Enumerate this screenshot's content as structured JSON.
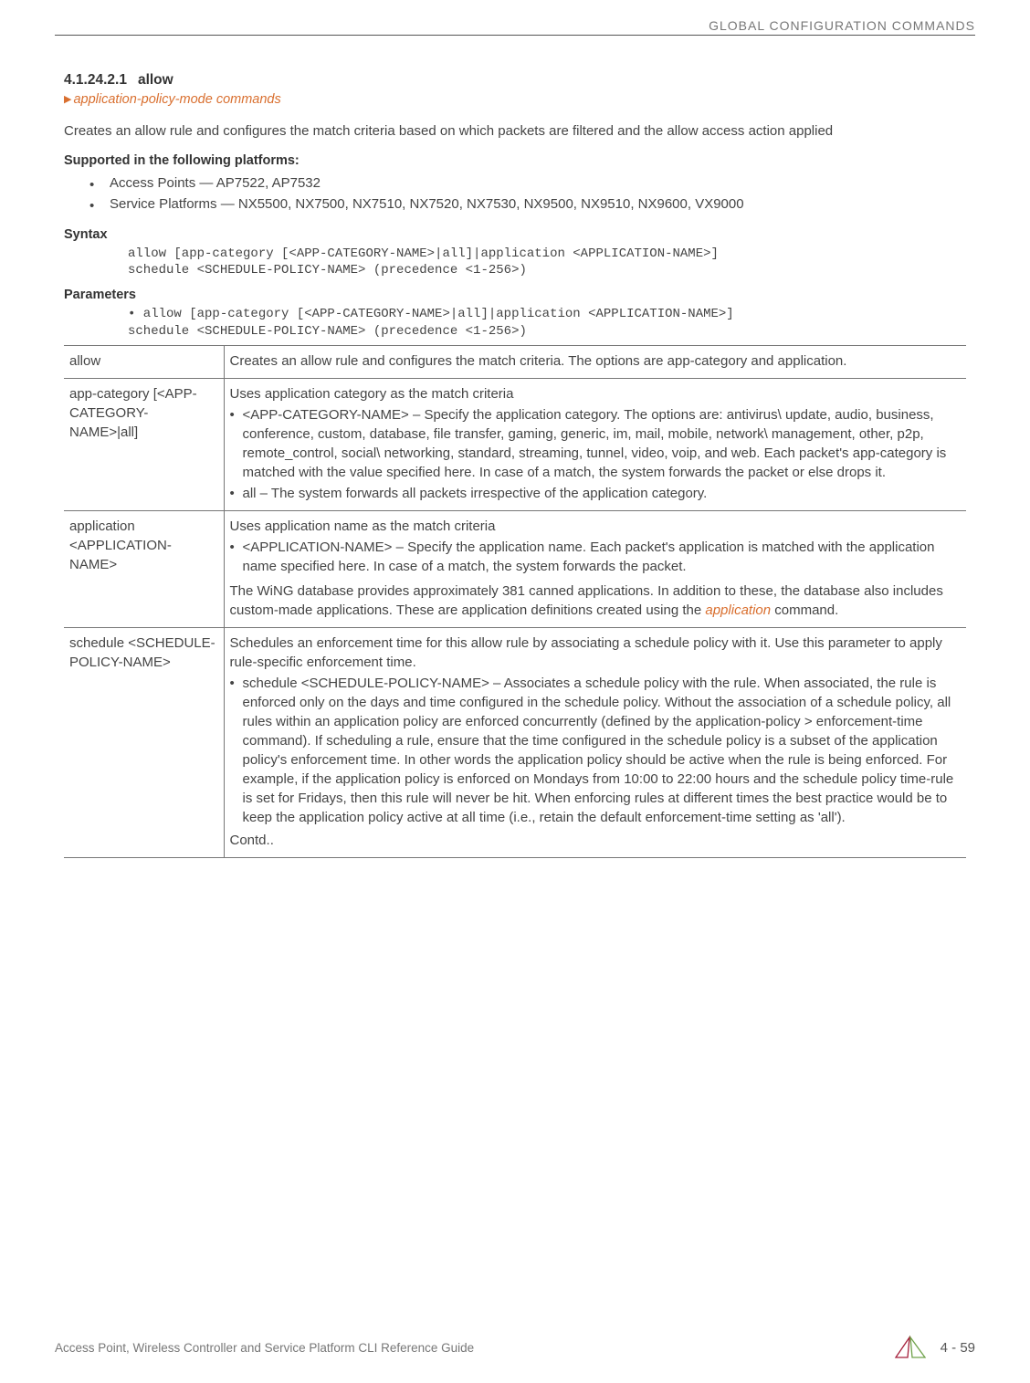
{
  "header": {
    "chapter": "GLOBAL CONFIGURATION COMMANDS"
  },
  "section": {
    "number": "4.1.24.2.1",
    "title": "allow",
    "breadcrumb": "application-policy-mode commands"
  },
  "intro": "Creates an allow rule and configures the match criteria based on which packets are filtered and the allow access action applied",
  "supported": {
    "heading": "Supported in the following platforms:",
    "items": [
      "Access Points — AP7522, AP7532",
      "Service Platforms — NX5500, NX7500, NX7510, NX7520, NX7530, NX9500, NX9510, NX9600, VX9000"
    ]
  },
  "syntax": {
    "heading": "Syntax",
    "code": "allow [app-category [<APP-CATEGORY-NAME>|all]|application <APPLICATION-NAME>]\nschedule <SCHEDULE-POLICY-NAME> (precedence <1-256>)"
  },
  "parameters": {
    "heading": "Parameters",
    "code": "• allow [app-category [<APP-CATEGORY-NAME>|all]|application <APPLICATION-NAME>]\nschedule <SCHEDULE-POLICY-NAME> (precedence <1-256>)",
    "rows": [
      {
        "key": "allow",
        "desc_intro": "Creates an allow rule and configures the match criteria. The options are app-category and application.",
        "bullets": [],
        "desc_outro": ""
      },
      {
        "key": "app-category [<APP-CATEGORY-NAME>|all]",
        "desc_intro": "Uses application category as the match criteria",
        "bullets": [
          "<APP-CATEGORY-NAME> – Specify the application category. The options are: antivirus\\ update, audio, business, conference, custom, database, file transfer, gaming, generic, im, mail, mobile, network\\ management, other, p2p, remote_control, social\\ networking, standard, streaming, tunnel, video, voip, and web. Each packet's app-category is matched with the value specified here. In case of a match, the system forwards the packet or else drops it.",
          "all – The system forwards all packets irrespective of the application category."
        ],
        "desc_outro": ""
      },
      {
        "key": "application <APPLICATION-NAME>",
        "desc_intro": "Uses application name as the match criteria",
        "bullets": [
          "<APPLICATION-NAME> – Specify the application name. Each packet's application is matched with the application name specified here. In case of a match, the system forwards the packet."
        ],
        "desc_outro_pre": "The WiNG database provides approximately 381 canned applications. In addition to these, the database also includes custom-made applications. These are application definitions created using the ",
        "desc_outro_link": "application",
        "desc_outro_post": " command."
      },
      {
        "key": "schedule <SCHEDULE-POLICY-NAME>",
        "desc_intro": "Schedules an enforcement time for this allow rule by associating a schedule policy with it. Use this parameter to apply rule-specific enforcement time.",
        "bullets": [
          "schedule <SCHEDULE-POLICY-NAME> – Associates a schedule policy with the rule. When associated, the rule is enforced only on the days and time configured in the schedule policy. Without the association of a schedule policy, all rules within an application policy are enforced concurrently (defined by the application-policy > enforcement-time command). If scheduling a rule, ensure that the time configured in the schedule policy is a subset of the application policy's enforcement time. In other words the application policy should be active when the rule is being enforced. For example, if the application policy is enforced on Mondays from 10:00 to 22:00 hours and the schedule policy time-rule is set for Fridays, then this rule will never be hit. When enforcing rules at different times the best practice would be to keep the application policy active at all time (i.e., retain the default enforcement-time setting as 'all')."
        ],
        "desc_outro": "Contd.."
      }
    ]
  },
  "footer": {
    "guide": "Access Point, Wireless Controller and Service Platform CLI Reference Guide",
    "page": "4 - 59"
  }
}
